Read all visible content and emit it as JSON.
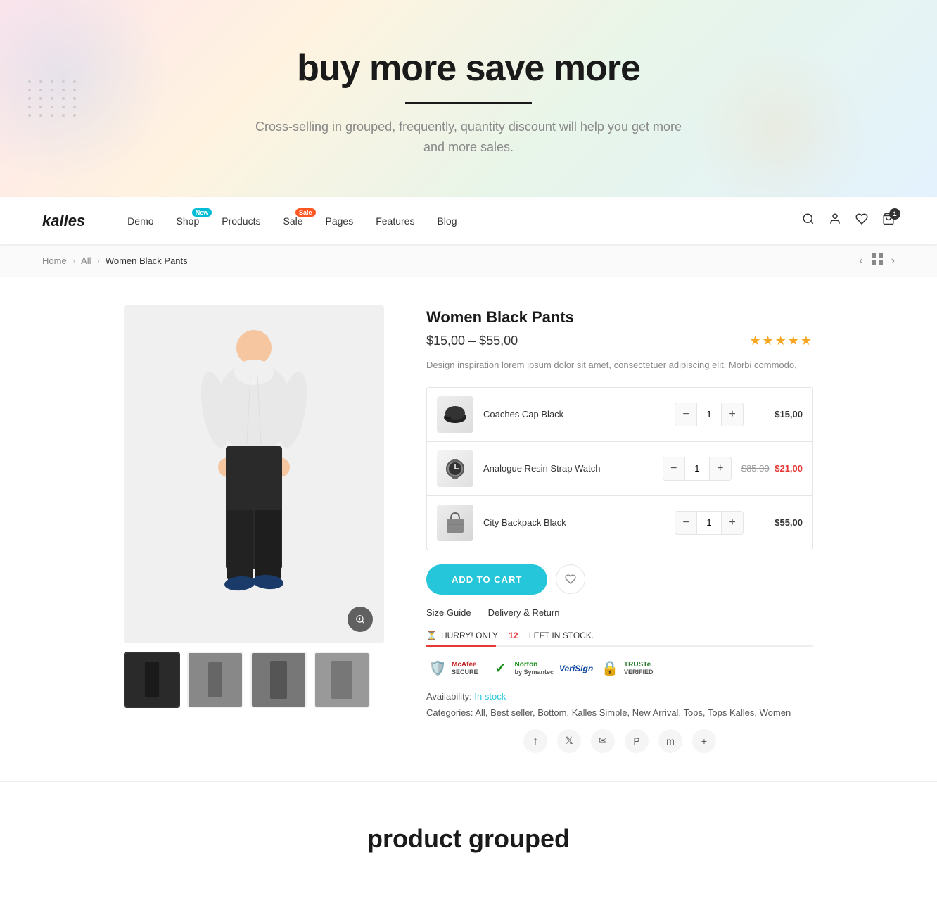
{
  "hero": {
    "title": "buy more save more",
    "subtitle": "Cross-selling in grouped, frequently,  quantity discount will help you get more and more sales."
  },
  "nav": {
    "logo": "kalles",
    "links": [
      {
        "label": "Demo",
        "badge": null
      },
      {
        "label": "Shop",
        "badge": "New"
      },
      {
        "label": "Products",
        "badge": null
      },
      {
        "label": "Sale",
        "badge": "Sale"
      },
      {
        "label": "Pages",
        "badge": null
      },
      {
        "label": "Features",
        "badge": null
      },
      {
        "label": "Blog",
        "badge": null
      }
    ],
    "cart_count": "1",
    "wishlist_count": "0"
  },
  "breadcrumb": {
    "home": "Home",
    "all": "All",
    "current": "Women Black Pants"
  },
  "product": {
    "title": "Women Black Pants",
    "price": "$15,00 – $55,00",
    "description": "Design inspiration lorem ipsum dolor sit amet, consectetuer adipiscing elit. Morbi commodo,",
    "availability": "In stock",
    "categories": "All, Best seller, Bottom, Kalles Simple, New Arrival, Tops, Tops Kalles, Women",
    "items": [
      {
        "name": "Coaches Cap Black",
        "qty": "1",
        "price": "$15,00",
        "original_price": null,
        "sale_price": null
      },
      {
        "name": "Analogue Resin Strap Watch",
        "qty": "1",
        "price": "$21,00",
        "original_price": "$85,00",
        "sale_price": "$21,00"
      },
      {
        "name": "City Backpack Black",
        "qty": "1",
        "price": "$55,00",
        "original_price": null,
        "sale_price": null
      }
    ],
    "add_to_cart": "ADD TO CART",
    "size_guide": "Size Guide",
    "delivery": "Delivery & Return",
    "stock_text": "HURRY! ONLY",
    "stock_count": "12",
    "stock_suffix": "LEFT IN STOCK.",
    "stock_percent": 18
  },
  "social": {
    "icons": [
      "f",
      "t",
      "✉",
      "p",
      "m",
      "+"
    ]
  },
  "footer": {
    "title": "product grouped"
  },
  "trust": [
    {
      "label": "McAfee SECURE",
      "icon": "🔒"
    },
    {
      "label": "Norton by Symantec",
      "icon": "✓"
    },
    {
      "label": "VeriSign",
      "icon": "✓"
    },
    {
      "label": "TRUSTe VERIFIED",
      "icon": "✓"
    }
  ]
}
